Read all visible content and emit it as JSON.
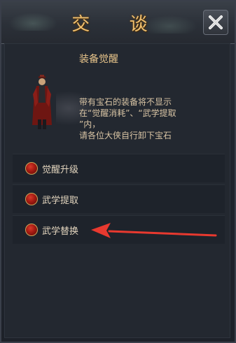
{
  "title": "交 谈",
  "header_title": "装备觉醒",
  "description": [
    "带有宝石的装备将不显示",
    "在“觉醒消耗”、“武学提取",
    "”内，",
    "请各位大侠自行卸下宝石"
  ],
  "options": [
    {
      "label": "觉醒升级"
    },
    {
      "label": "武学提取"
    },
    {
      "label": "武学替换"
    }
  ],
  "colors": {
    "title": "#f0c070",
    "header": "#e7c48a",
    "arrow": "#e8392f",
    "bullet": "#a31a12"
  },
  "icons": {
    "close": "close-x-icon",
    "bullet": "red-orb-icon",
    "pointer": "red-arrow-icon"
  }
}
